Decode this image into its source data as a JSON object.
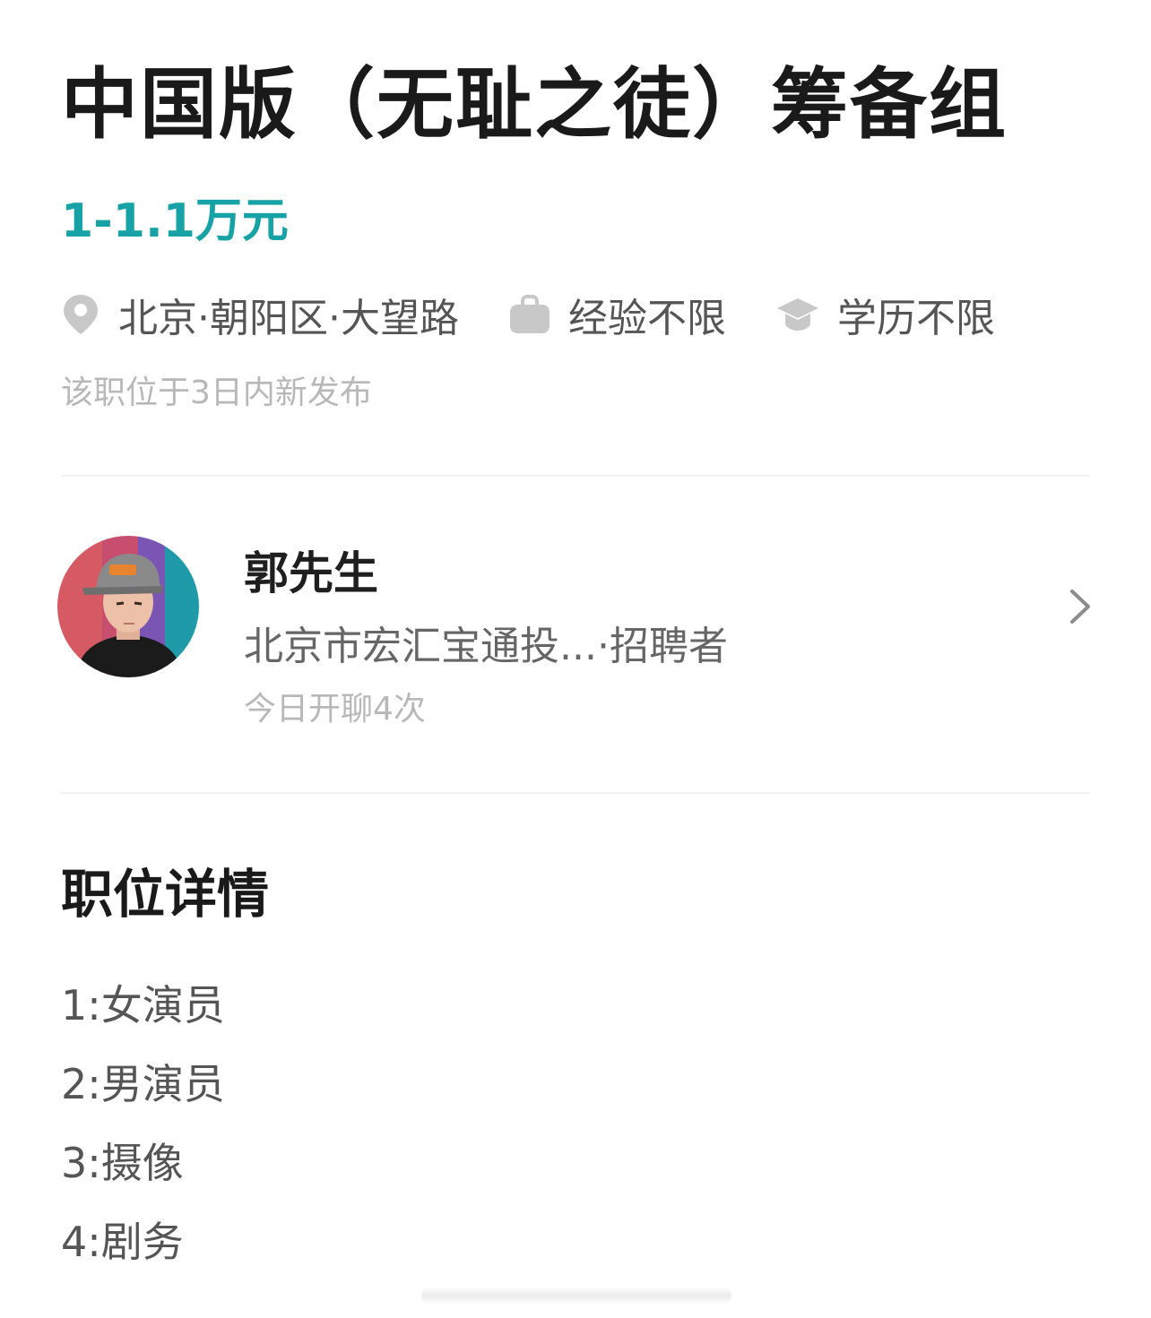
{
  "job": {
    "title": "中国版（无耻之徒）筹备组",
    "salary": "1-1.1万元",
    "location": "北京·朝阳区·大望路",
    "experience": "经验不限",
    "education": "学历不限",
    "posted": "该职位于3日内新发布"
  },
  "recruiter": {
    "name": "郭先生",
    "company_role": "北京市宏汇宝通投...·招聘者",
    "activity": "今日开聊4次"
  },
  "details": {
    "heading": "职位详情",
    "items": [
      "1:女演员",
      "2:男演员",
      "3:摄像",
      "4:剧务"
    ]
  },
  "icons": {
    "location": "location-pin-icon",
    "experience": "briefcase-icon",
    "education": "graduation-cap-icon",
    "chevron": "chevron-right-icon"
  },
  "colors": {
    "salary": "#17a2a6",
    "icon": "#c8c8c8"
  }
}
